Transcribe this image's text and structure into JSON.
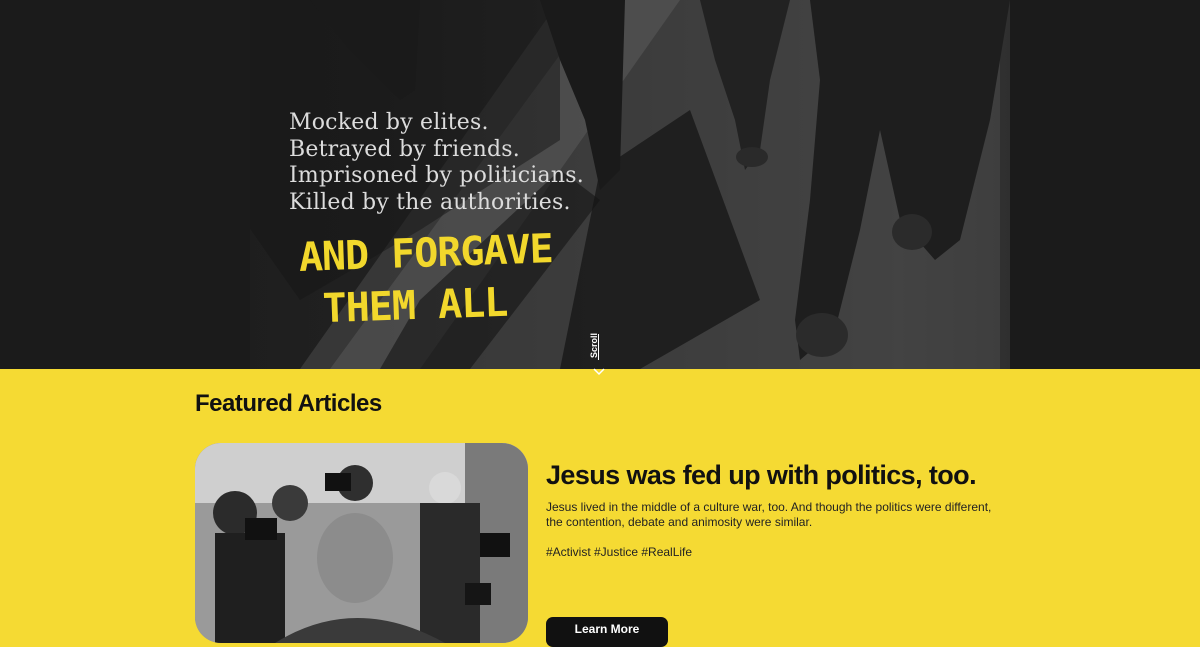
{
  "hero": {
    "lines": [
      "Mocked by elites.",
      "Betrayed by friends.",
      "Imprisoned by politicians.",
      "Killed by the authorities."
    ],
    "tagline_line1": "AND FORGAVE",
    "tagline_line2": "THEM ALL",
    "scroll_label": "Scroll",
    "accent_color": "#f2d82c"
  },
  "featured": {
    "heading": "Featured Articles",
    "article": {
      "title": "Jesus was fed up with politics, too.",
      "description": "Jesus lived in the middle of a culture war, too. And though the politics were different, the contention, debate and animosity were similar.",
      "tags": "#Activist #Justice #RealLife",
      "button_label": "Learn More"
    }
  },
  "colors": {
    "background": "#f5da33",
    "text": "#111111",
    "button": "#111111"
  }
}
